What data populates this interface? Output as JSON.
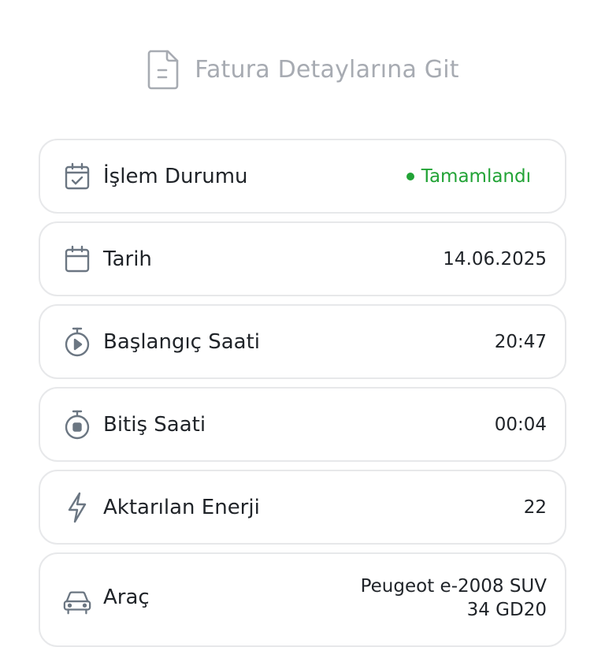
{
  "invoice_link": {
    "label": "Fatura Detaylarına Git",
    "icon": "document-icon"
  },
  "status_color": "#22a336",
  "rows": [
    {
      "label": "İşlem Durumu",
      "value": "Tamamlandı",
      "icon": "calendar-check-icon"
    },
    {
      "label": "Tarih",
      "value": "14.06.2025",
      "icon": "calendar-icon"
    },
    {
      "label": "Başlangıç Saati",
      "value": "20:47",
      "icon": "timer-play-icon"
    },
    {
      "label": "Bitiş Saati",
      "value": "00:04",
      "icon": "timer-stop-icon"
    },
    {
      "label": "Aktarılan Enerji",
      "value": "22",
      "icon": "lightning-icon"
    },
    {
      "label": "Araç",
      "value_line1": "Peugeot e-2008 SUV",
      "value_line2": "34 GD20",
      "icon": "car-icon"
    }
  ]
}
